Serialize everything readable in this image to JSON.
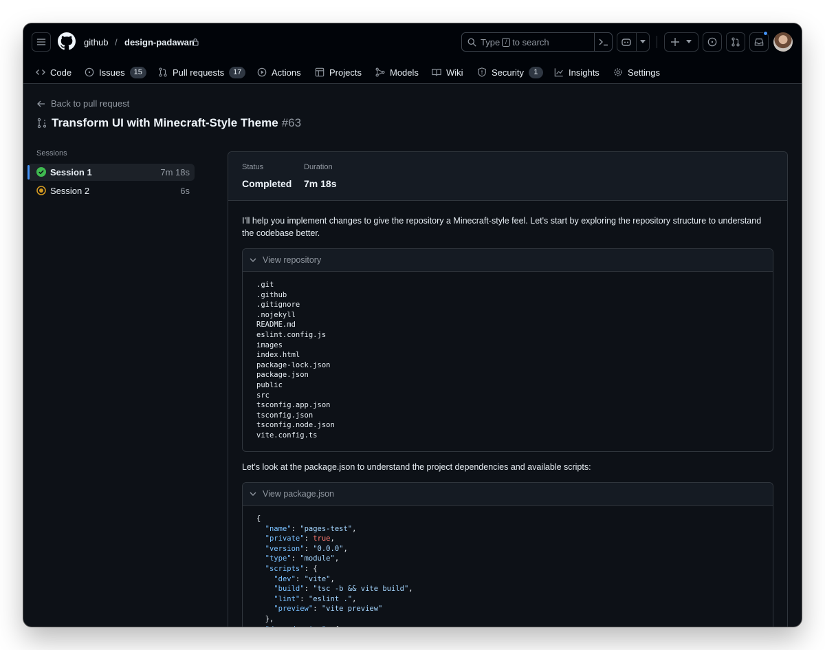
{
  "topbar": {
    "owner": "github",
    "separator": "/",
    "repo": "design-padawan",
    "search": {
      "prefix": "Type",
      "key": "/",
      "suffix": "to search"
    }
  },
  "nav": {
    "items": [
      {
        "label": "Code",
        "icon": "code-icon"
      },
      {
        "label": "Issues",
        "icon": "issue-icon",
        "count": "15"
      },
      {
        "label": "Pull requests",
        "icon": "pull-request-icon",
        "count": "17"
      },
      {
        "label": "Actions",
        "icon": "play-icon"
      },
      {
        "label": "Projects",
        "icon": "table-icon"
      },
      {
        "label": "Models",
        "icon": "models-icon"
      },
      {
        "label": "Wiki",
        "icon": "book-icon"
      },
      {
        "label": "Security",
        "icon": "shield-icon",
        "count": "1"
      },
      {
        "label": "Insights",
        "icon": "graph-icon"
      },
      {
        "label": "Settings",
        "icon": "gear-icon"
      }
    ]
  },
  "page": {
    "back_label": "Back to pull request",
    "title": "Transform UI with Minecraft-Style Theme",
    "pr_number": "#63",
    "sessions_label": "Sessions",
    "sessions": [
      {
        "name": "Session 1",
        "duration": "7m 18s",
        "status": "success"
      },
      {
        "name": "Session 2",
        "duration": "6s",
        "status": "in-progress"
      }
    ]
  },
  "session_detail": {
    "status_label": "Status",
    "status_value": "Completed",
    "duration_label": "Duration",
    "duration_value": "7m 18s",
    "message_1": "I'll help you implement changes to give the repository a Minecraft-style feel. Let's start by exploring the repository structure to understand the codebase better.",
    "tool_1_label": "View repository",
    "repo_files": [
      ".git",
      ".github",
      ".gitignore",
      ".nojekyll",
      "README.md",
      "eslint.config.js",
      "images",
      "index.html",
      "package-lock.json",
      "package.json",
      "public",
      "src",
      "tsconfig.app.json",
      "tsconfig.json",
      "tsconfig.node.json",
      "vite.config.ts"
    ],
    "message_2": "Let's look at the package.json to understand the project dependencies and available scripts:",
    "tool_2_label": "View package.json",
    "package_json_lines": [
      "{",
      "  \"name\": \"pages-test\",",
      "  \"private\": true,",
      "  \"version\": \"0.0.0\",",
      "  \"type\": \"module\",",
      "  \"scripts\": {",
      "    \"dev\": \"vite\",",
      "    \"build\": \"tsc -b && vite build\",",
      "    \"lint\": \"eslint .\",",
      "    \"preview\": \"vite preview\"",
      "  },",
      "  \"dependencies\": {"
    ]
  },
  "colors": {
    "background": "#0d1117",
    "header": "#010409",
    "border": "#30363d",
    "accent": "#4493f8",
    "success": "#3fb950",
    "in_progress": "#d29922"
  }
}
